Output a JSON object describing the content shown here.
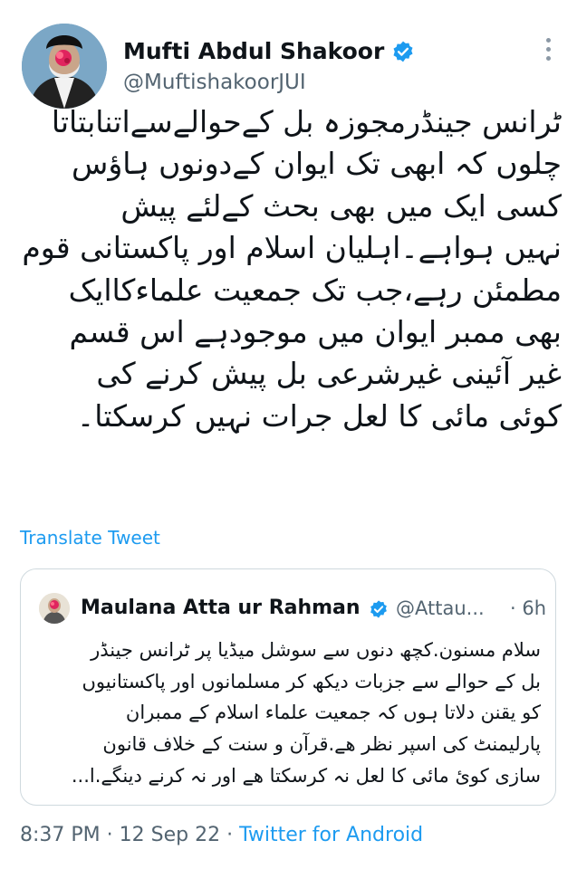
{
  "author": {
    "name": "Mufti Abdul Shakoor",
    "handle": "@MuftishakoorJUI",
    "verified": true,
    "avatar_icon": "profile-photo"
  },
  "tweet": {
    "lines": [
      "ٹرانس جینڈرمجوزہ بل کےحوالےسےاتنابتاتا",
      "چلوں کہ ابھی تک ایوان کےدونوں ہاؤس",
      "کسی ایک میں بھی بحث کےلئے پیش",
      "نہیں ہواہے۔اہلیان اسلام اور پاکستانی قوم",
      "مطمئن رہے،جب تک جمعیت علماءکاایک",
      "بھی ممبر ایوان میں موجودہے اس قسم",
      "غیر آئینی غیرشرعی بل پیش کرنے کی",
      "کوئی مائی کا لعل جرات نہیں کرسکتا۔"
    ],
    "translate_label": "Translate Tweet"
  },
  "quoted": {
    "name": "Maulana Atta ur Rahman",
    "handle": "@Attau...",
    "separator": "·",
    "time": "6h",
    "verified": true,
    "lines": [
      "سلام مسنون.کچھ دنوں سے سوشل میڈیا پر ٹرانس جینڈر",
      "بل کے حوالے سے جزبات دیکھ کر مسلمانوں اور پاکستانیوں",
      "کو یقنن دلاتا ہوں کہ جمعیت علماء اسلام کے ممبران",
      "پارلیمنٹ کی اسپر نظر ھے.قرآن و سنت کے خلاف قانون",
      "سازی کوئ مائی کا لعل نہ کرسکتا ھے اور نہ کرنے دینگے.ا..."
    ]
  },
  "footer": {
    "time": "8:37 PM",
    "sep1": " · ",
    "date": "12 Sep 22",
    "sep2": " · ",
    "source": "Twitter for Android"
  },
  "colors": {
    "link": "#1d9bf0",
    "muted": "#536471",
    "text": "#0f1419",
    "border": "#cfd9de"
  }
}
